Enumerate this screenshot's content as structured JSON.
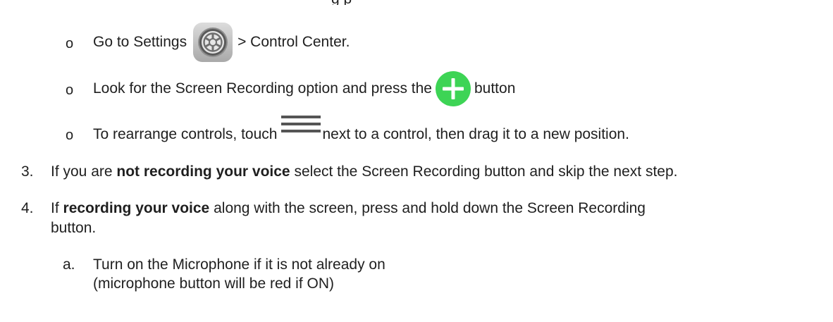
{
  "top_fragment": "g p",
  "bullets": {
    "settings": {
      "marker": "o",
      "text_before": "Go to Settings",
      "icon": "settings-gear-icon",
      "text_after": "> Control Center."
    },
    "look_for": {
      "marker": "o",
      "text_before": "Look for the Screen Recording option and press the",
      "icon": "green-plus-icon",
      "text_after": "button"
    },
    "rearrange": {
      "marker": "o",
      "text_before": "To rearrange controls, touch",
      "icon": "hamburger-menu-icon",
      "text_after": "next to a control, then drag it to a new position."
    }
  },
  "steps": {
    "step3": {
      "number": "3.",
      "text_before": "If you are",
      "bold": "not recording your voice",
      "text_after": "select the Screen Recording button and skip the next step."
    },
    "step4": {
      "number": "4.",
      "text_before": "If",
      "bold": "recording your voice",
      "text_after": "along with the screen, press and hold down the Screen Recording",
      "continuation": "button."
    }
  },
  "substeps": {
    "a": {
      "letter": "a.",
      "line1": "Turn on the Microphone if it is not already on",
      "line2": "(microphone button will be red if ON)"
    }
  },
  "colors": {
    "plus_green": "#3dd455",
    "text": "#1f1f1f"
  }
}
